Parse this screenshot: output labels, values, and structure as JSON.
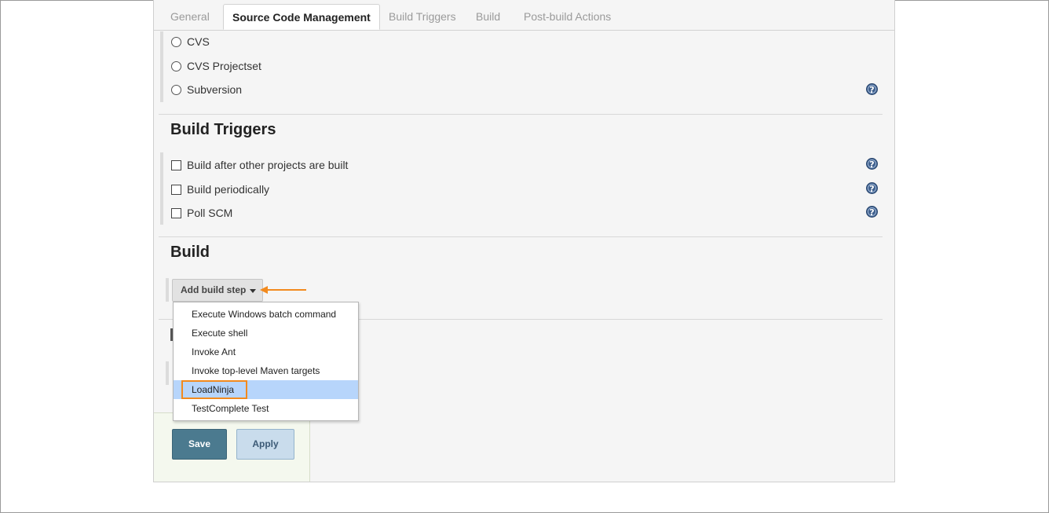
{
  "tabs": [
    {
      "label": "General",
      "active": false
    },
    {
      "label": "Source Code Management",
      "active": true
    },
    {
      "label": "Build Triggers",
      "active": false
    },
    {
      "label": "Build",
      "active": false
    },
    {
      "label": "Post-build Actions",
      "active": false
    }
  ],
  "scm": {
    "options": [
      "CVS",
      "CVS Projectset",
      "Subversion"
    ]
  },
  "build_triggers": {
    "heading": "Build Triggers",
    "options": [
      "Build after other projects are built",
      "Build periodically",
      "Poll SCM"
    ]
  },
  "build": {
    "heading": "Build",
    "add_step_label": "Add build step",
    "menu_items": [
      "Execute Windows batch command",
      "Execute shell",
      "Invoke Ant",
      "Invoke top-level Maven targets",
      "LoadNinja",
      "TestComplete Test"
    ],
    "highlighted_item": "LoadNinja"
  },
  "actions": {
    "save_label": "Save",
    "apply_label": "Apply"
  },
  "colors": {
    "accent_annotation": "#f28a1e",
    "save_button": "#4b7a8f",
    "apply_button": "#c9dcec",
    "menu_highlight": "#b7d5fb"
  },
  "icons": {
    "help": "help-icon",
    "dropdown": "chevron-down-icon",
    "annotation": "arrow-left-icon"
  }
}
